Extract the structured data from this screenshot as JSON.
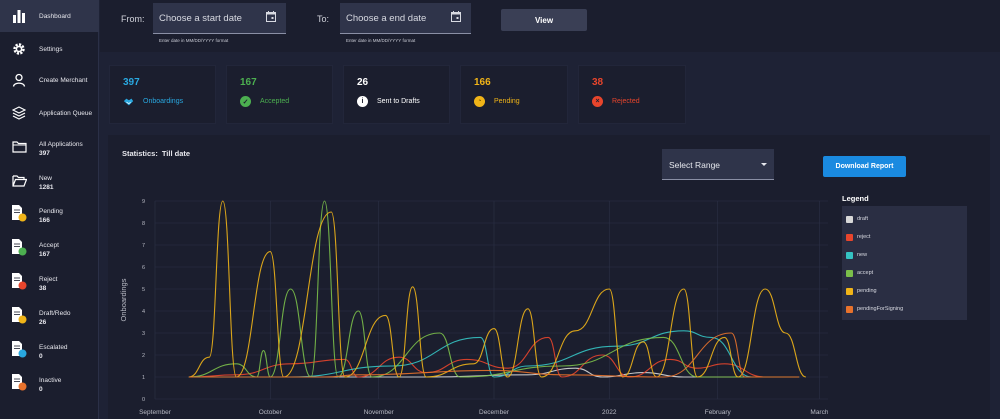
{
  "sidebar": {
    "items": [
      {
        "label": "Dashboard",
        "count": "",
        "icon": "bar-chart-icon"
      },
      {
        "label": "Settings",
        "count": "",
        "icon": "gear-icon"
      },
      {
        "label": "Create Merchant",
        "count": "",
        "icon": "user-icon"
      },
      {
        "label": "Application Queue",
        "count": "",
        "icon": "layers-icon"
      },
      {
        "label": "All Applications",
        "count": "397",
        "icon": "folder-icon"
      },
      {
        "label": "New",
        "count": "1281",
        "icon": "folder-open-icon"
      },
      {
        "label": "Pending",
        "count": "166",
        "icon": "doc-pending-icon"
      },
      {
        "label": "Accept",
        "count": "167",
        "icon": "doc-accept-icon"
      },
      {
        "label": "Reject",
        "count": "38",
        "icon": "doc-reject-icon"
      },
      {
        "label": "Draft/Redo",
        "count": "26",
        "icon": "doc-draft-icon"
      },
      {
        "label": "Escalated",
        "count": "0",
        "icon": "doc-escalated-icon"
      },
      {
        "label": "Inactive",
        "count": "0",
        "icon": "doc-inactive-icon"
      }
    ]
  },
  "filter": {
    "from_label": "From:",
    "to_label": "To:",
    "start_placeholder": "Choose a start date",
    "end_placeholder": "Choose a end date",
    "date_hint": "Enter date in MM/DD/YYYY format",
    "view_label": "View"
  },
  "cards": [
    {
      "value": "397",
      "label": "Onboardings",
      "color": "#29a8e0"
    },
    {
      "value": "167",
      "label": "Accepted",
      "color": "#4caf50"
    },
    {
      "value": "26",
      "label": "Sent to Drafts",
      "color": "#ffffff"
    },
    {
      "value": "166",
      "label": "Pending",
      "color": "#f0b418"
    },
    {
      "value": "38",
      "label": "Rejected",
      "color": "#e8452c"
    }
  ],
  "statistics": {
    "label": "Statistics:",
    "period": "Till date",
    "range_label": "Select Range",
    "download_label": "Download Report",
    "legend_title": "Legend"
  },
  "chart_data": {
    "type": "line",
    "ylabel": "Onboardings",
    "ylim": [
      0,
      9
    ],
    "yticks": [
      "0",
      "1",
      "2",
      "3",
      "4",
      "5",
      "6",
      "7",
      "8",
      "9"
    ],
    "xticks": [
      "September",
      "October",
      "November",
      "December",
      "2022",
      "February",
      "March"
    ],
    "legend_placement": "right",
    "series": [
      {
        "name": "draft",
        "color": "#d8d8d8",
        "points": [
          [
            0.05,
            1
          ],
          [
            0.4,
            1
          ],
          [
            0.55,
            1.1
          ],
          [
            0.62,
            1.4
          ],
          [
            0.66,
            1
          ],
          [
            0.72,
            1.2
          ],
          [
            0.78,
            1
          ],
          [
            0.95,
            1
          ]
        ]
      },
      {
        "name": "reject",
        "color": "#e8452c",
        "points": [
          [
            0.05,
            1
          ],
          [
            0.12,
            1.1
          ],
          [
            0.2,
            1.6
          ],
          [
            0.28,
            1.8
          ],
          [
            0.3,
            1
          ],
          [
            0.36,
            1.9
          ],
          [
            0.4,
            1.2
          ],
          [
            0.46,
            1.8
          ],
          [
            0.52,
            1.4
          ],
          [
            0.58,
            2.8
          ],
          [
            0.6,
            1
          ],
          [
            0.66,
            2.0
          ],
          [
            0.7,
            1
          ],
          [
            0.76,
            1.8
          ],
          [
            0.8,
            1.4
          ],
          [
            0.84,
            1.6
          ],
          [
            0.9,
            1
          ],
          [
            0.95,
            1
          ]
        ]
      },
      {
        "name": "new",
        "color": "#35c3c3",
        "points": [
          [
            0.05,
            1
          ],
          [
            0.2,
            1
          ],
          [
            0.35,
            1.5
          ],
          [
            0.48,
            2.8
          ],
          [
            0.5,
            1
          ],
          [
            0.55,
            1.5
          ],
          [
            0.68,
            2.4
          ],
          [
            0.78,
            3.1
          ],
          [
            0.82,
            2.8
          ],
          [
            0.88,
            1
          ],
          [
            0.95,
            1
          ]
        ]
      },
      {
        "name": "accept",
        "color": "#7bbf4a",
        "points": [
          [
            0.05,
            1
          ],
          [
            0.12,
            1.6
          ],
          [
            0.15,
            1
          ],
          [
            0.16,
            2.2
          ],
          [
            0.17,
            1
          ],
          [
            0.2,
            5.0
          ],
          [
            0.23,
            1
          ],
          [
            0.25,
            9.0
          ],
          [
            0.27,
            1
          ],
          [
            0.3,
            4.0
          ],
          [
            0.32,
            1
          ],
          [
            0.42,
            3.0
          ],
          [
            0.45,
            1
          ],
          [
            0.6,
            1.5
          ],
          [
            0.75,
            2.8
          ],
          [
            0.8,
            1
          ],
          [
            0.95,
            1
          ]
        ]
      },
      {
        "name": "pending",
        "color": "#f0b418",
        "points": [
          [
            0.05,
            1
          ],
          [
            0.08,
            1.9
          ],
          [
            0.1,
            9.0
          ],
          [
            0.12,
            1
          ],
          [
            0.17,
            6.7
          ],
          [
            0.19,
            1
          ],
          [
            0.26,
            8.5
          ],
          [
            0.28,
            1
          ],
          [
            0.34,
            3.8
          ],
          [
            0.36,
            1
          ],
          [
            0.38,
            5.1
          ],
          [
            0.4,
            1
          ],
          [
            0.47,
            1.6
          ],
          [
            0.5,
            3.2
          ],
          [
            0.52,
            1
          ],
          [
            0.55,
            4.1
          ],
          [
            0.57,
            1
          ],
          [
            0.62,
            3.1
          ],
          [
            0.67,
            5.0
          ],
          [
            0.69,
            1
          ],
          [
            0.72,
            2.6
          ],
          [
            0.74,
            1
          ],
          [
            0.78,
            5.0
          ],
          [
            0.8,
            1
          ],
          [
            0.84,
            2.8
          ],
          [
            0.86,
            1
          ],
          [
            0.9,
            5.0
          ],
          [
            0.93,
            3.0
          ],
          [
            0.96,
            1
          ]
        ]
      },
      {
        "name": "pendingForSigning",
        "color": "#e8722c",
        "points": [
          [
            0.05,
            1
          ],
          [
            0.25,
            1
          ],
          [
            0.3,
            1.1
          ],
          [
            0.5,
            1.3
          ],
          [
            0.6,
            1.1
          ],
          [
            0.75,
            1
          ],
          [
            0.85,
            3.0
          ],
          [
            0.87,
            1
          ],
          [
            0.95,
            1
          ]
        ]
      }
    ]
  }
}
